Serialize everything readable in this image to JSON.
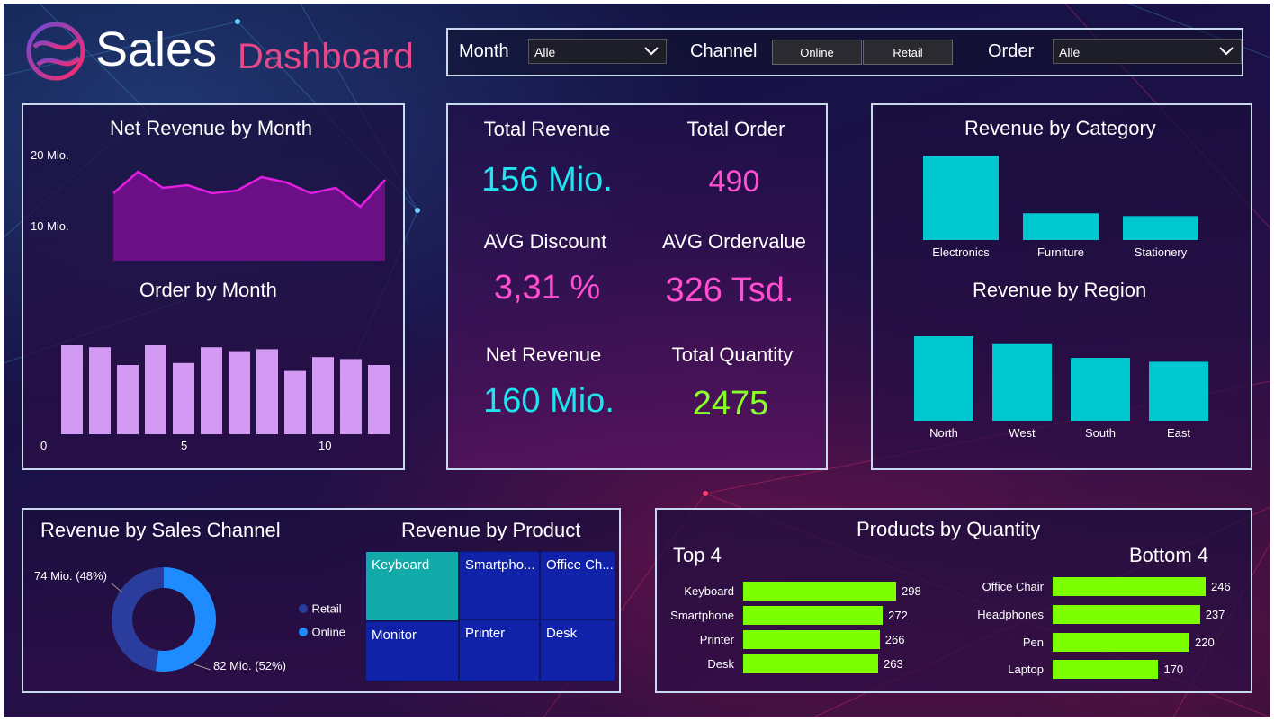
{
  "header": {
    "title_part1": "Sales",
    "title_part2": "Dashboard",
    "logo_icon": "globe-logo-icon"
  },
  "filters": {
    "month_label": "Month",
    "month_value": "Alle",
    "channel_label": "Channel",
    "channel_options": [
      "Online",
      "Retail"
    ],
    "order_label": "Order",
    "order_value": "Alle"
  },
  "net_revenue_by_month": {
    "title": "Net Revenue by Month",
    "y_ticks": [
      "20 Mio.",
      "10 Mio."
    ],
    "color": "#e21ee0"
  },
  "order_by_month": {
    "title": "Order by Month",
    "x_ticks": [
      "0",
      "5",
      "10"
    ],
    "color": "#d29af2"
  },
  "kpis": {
    "total_revenue_label": "Total Revenue",
    "total_revenue_value": "156 Mio.",
    "total_order_label": "Total Order",
    "total_order_value": "490",
    "avg_discount_label": "AVG Discount",
    "avg_discount_value": "3,31 %",
    "avg_ordervalue_label": "AVG Ordervalue",
    "avg_ordervalue_value": "326 Tsd.",
    "net_revenue_label": "Net Revenue",
    "net_revenue_value": "160 Mio.",
    "total_quantity_label": "Total Quantity",
    "total_quantity_value": "2475",
    "colors": {
      "cyan": "#21e3f0",
      "pink": "#ff4fd0",
      "green": "#8aff2a"
    }
  },
  "revenue_by_category": {
    "title": "Revenue by Category",
    "color": "#00c8d0"
  },
  "revenue_by_region": {
    "title": "Revenue by Region",
    "color": "#00c8d0"
  },
  "revenue_by_channel": {
    "title": "Revenue by Sales Channel",
    "label_retail_value": "74 Mio. (48%)",
    "label_online_value": "82 Mio. (52%)",
    "legend": [
      {
        "name": "Retail",
        "color": "#2a3d9c"
      },
      {
        "name": "Online",
        "color": "#1e8cff"
      }
    ]
  },
  "revenue_by_product": {
    "title": "Revenue by Product",
    "tiles": [
      "Keyboard",
      "Smartpho...",
      "Office Ch...",
      "Monitor",
      "Printer",
      "Desk"
    ]
  },
  "products_by_quantity": {
    "title": "Products by Quantity",
    "top_label": "Top 4",
    "bottom_label": "Bottom 4",
    "color": "#7cff00"
  },
  "chart_data": [
    {
      "type": "area",
      "title": "Net Revenue by Month",
      "x": [
        1,
        2,
        3,
        4,
        5,
        6,
        7,
        8,
        9,
        10,
        11,
        12
      ],
      "values": [
        12.5,
        16.5,
        13.5,
        14,
        12.5,
        13,
        15.5,
        14.5,
        12.5,
        13.5,
        10,
        15
      ],
      "ylabel": "",
      "ylim": [
        0,
        20
      ],
      "y_unit": "Mio."
    },
    {
      "type": "bar",
      "title": "Order by Month",
      "x": [
        1,
        2,
        3,
        4,
        5,
        6,
        7,
        8,
        9,
        10,
        11,
        12
      ],
      "values": [
        45,
        44,
        35,
        45,
        36,
        44,
        42,
        43,
        32,
        39,
        38,
        35
      ],
      "xlim": [
        0,
        12.5
      ],
      "ylim": [
        0,
        50
      ]
    },
    {
      "type": "bar",
      "title": "Revenue by Category",
      "categories": [
        "Electronics",
        "Furniture",
        "Stationery"
      ],
      "values": [
        60,
        19,
        17
      ]
    },
    {
      "type": "bar",
      "title": "Revenue by Region",
      "categories": [
        "North",
        "West",
        "South",
        "East"
      ],
      "values": [
        43,
        39,
        32,
        30
      ]
    },
    {
      "type": "pie",
      "title": "Revenue by Sales Channel",
      "categories": [
        "Retail",
        "Online"
      ],
      "values": [
        74,
        82
      ],
      "percent": [
        48,
        52
      ]
    },
    {
      "type": "bar",
      "title": "Top 4",
      "categories": [
        "Keyboard",
        "Smartphone",
        "Printer",
        "Desk"
      ],
      "values": [
        298,
        272,
        266,
        263
      ]
    },
    {
      "type": "bar",
      "title": "Bottom 4",
      "categories": [
        "Office Chair",
        "Headphones",
        "Pen",
        "Laptop"
      ],
      "values": [
        246,
        237,
        220,
        170
      ]
    }
  ]
}
